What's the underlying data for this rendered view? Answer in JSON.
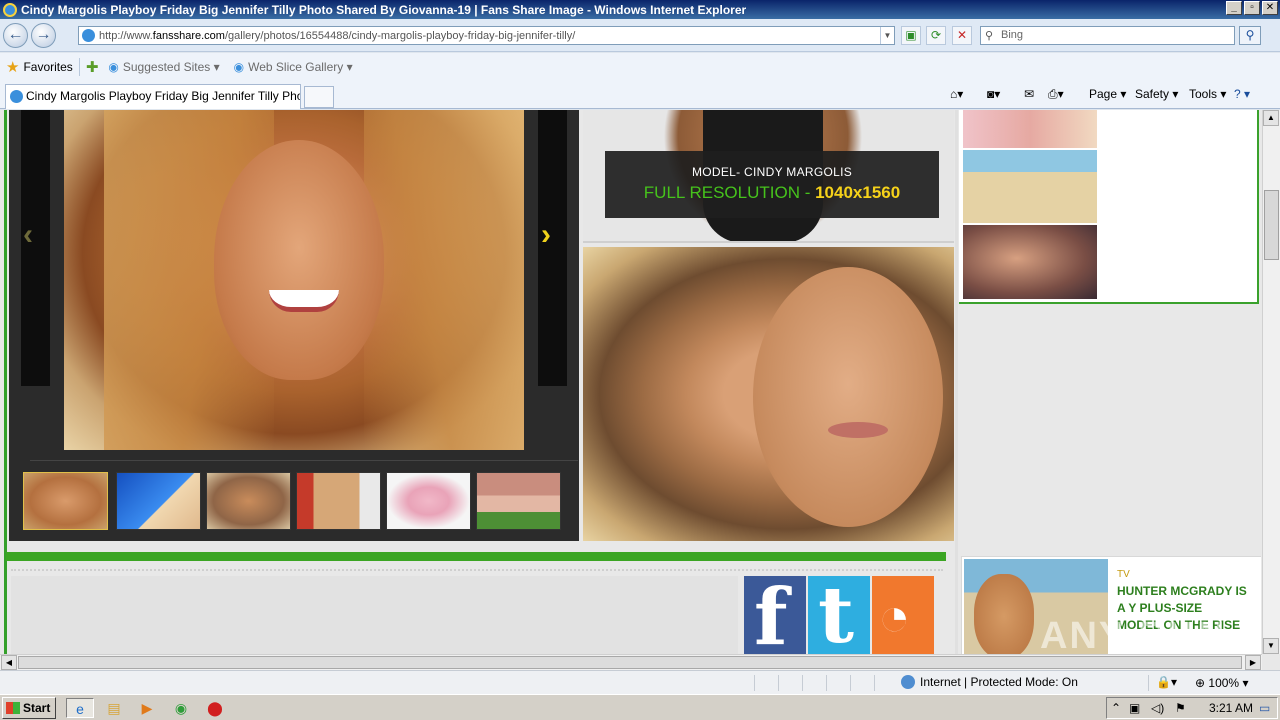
{
  "window": {
    "title": "Cindy Margolis Playboy Friday Big Jennifer Tilly Photo Shared By Giovanna-19 | Fans Share Image - Windows Internet Explorer",
    "controls": [
      "_",
      "▫",
      "✕"
    ]
  },
  "address_bar": {
    "url_prefix": "http://www.",
    "url_domain": "fansshare.com",
    "url_rest": "/gallery/photos/16554488/cindy-margolis-playboy-friday-big-jennifer-tilly/",
    "search_placeholder": "Bing"
  },
  "favorites_bar": {
    "favorites_label": "Favorites",
    "suggested_sites": "Suggested Sites ▾",
    "web_slice_gallery": "Web Slice Gallery ▾"
  },
  "tabs": [
    {
      "label": "Cindy Margolis Playboy Friday Big Jennifer Tilly Photo ..."
    }
  ],
  "command_bar": {
    "page": "Page ▾",
    "safety": "Safety ▾",
    "tools": "Tools ▾",
    "help": "? ▾"
  },
  "gallery": {
    "prev_arrow": "‹",
    "next_arrow": "›",
    "model_label": "MODEL- CINDY MARGOLIS",
    "resolution_label": "FULL RESOLUTION - ",
    "resolution_value": "1040x1560"
  },
  "news": {
    "category": "TV",
    "headline": "HUNTER MCGRADY IS A Y PLUS-SIZE MODEL ON THE RISE"
  },
  "watermark": "ANY RUN",
  "status_bar": {
    "zone": "Internet | Protected Mode: On",
    "zoom": "100%"
  },
  "taskbar": {
    "start_label": "Start",
    "clock": "3:21 AM"
  },
  "colors": {
    "accent_green": "#3ba523",
    "resolution_green": "#46c21c",
    "resolution_yellow": "#f6d21a",
    "news_headline": "#2d7f1e"
  }
}
